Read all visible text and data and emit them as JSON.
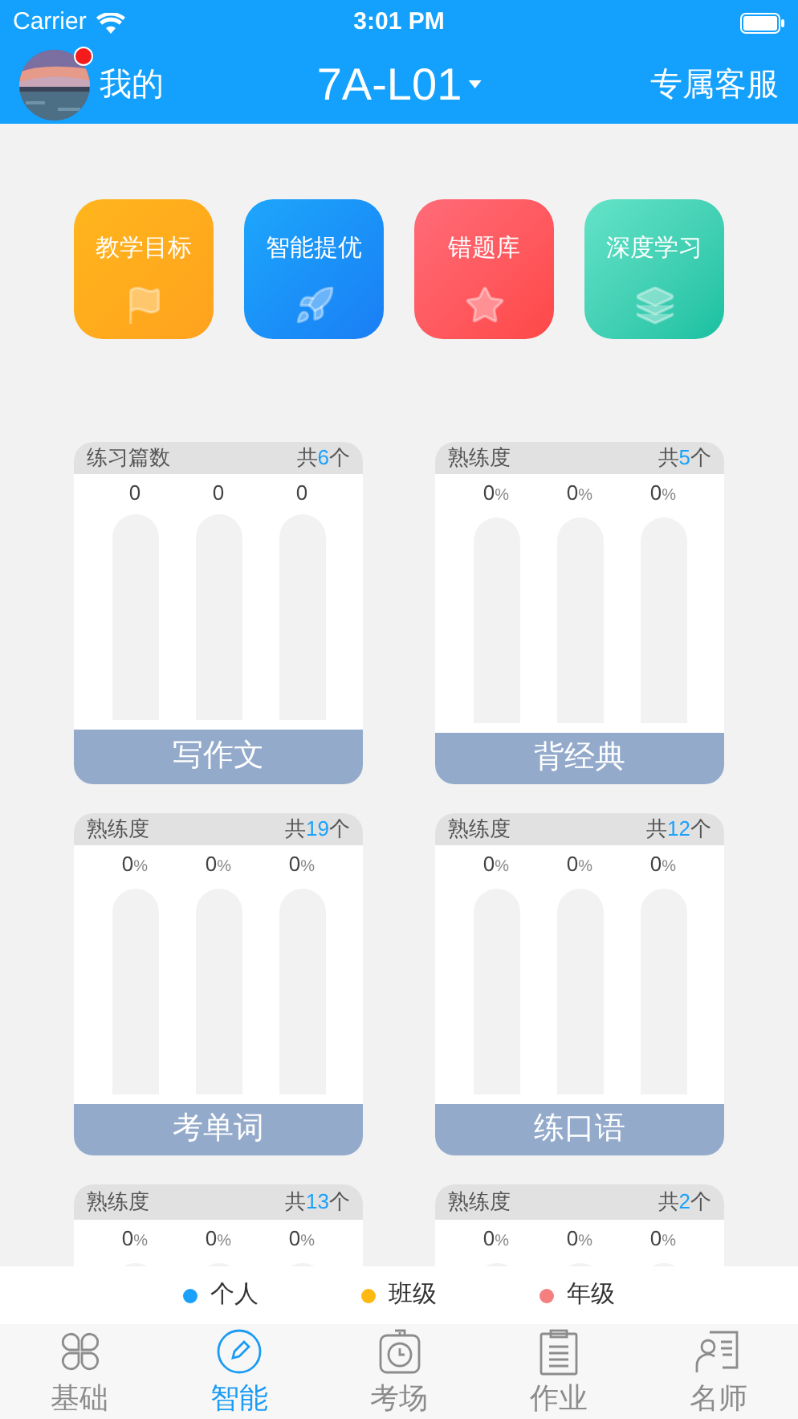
{
  "status_bar": {
    "carrier": "Carrier",
    "time": "3:01 PM"
  },
  "header": {
    "profile_label": "我的",
    "has_notification": true,
    "class_name": "7A-L01",
    "service": "专属客服"
  },
  "tiles": [
    {
      "label": "教学目标",
      "kind": "flag"
    },
    {
      "label": "智能提优",
      "kind": "rocket"
    },
    {
      "label": "错题库",
      "kind": "star"
    },
    {
      "label": "深度学习",
      "kind": "layers"
    }
  ],
  "cards": [
    {
      "title": "练习篇数",
      "total_prefix": "共",
      "total": "6",
      "total_suffix": "个",
      "bars": [
        {
          "value": "0"
        },
        {
          "value": "0"
        },
        {
          "value": "0"
        }
      ],
      "action": "写作文"
    },
    {
      "title": "熟练度",
      "total_prefix": "共",
      "total": "5",
      "total_suffix": "个",
      "bars": [
        {
          "value": "0",
          "unit": "%"
        },
        {
          "value": "0",
          "unit": "%"
        },
        {
          "value": "0",
          "unit": "%"
        }
      ],
      "action": "背经典"
    },
    {
      "title": "熟练度",
      "total_prefix": "共",
      "total": "19",
      "total_suffix": "个",
      "bars": [
        {
          "value": "0",
          "unit": "%"
        },
        {
          "value": "0",
          "unit": "%"
        },
        {
          "value": "0",
          "unit": "%"
        }
      ],
      "action": "考单词"
    },
    {
      "title": "熟练度",
      "total_prefix": "共",
      "total": "12",
      "total_suffix": "个",
      "bars": [
        {
          "value": "0",
          "unit": "%"
        },
        {
          "value": "0",
          "unit": "%"
        },
        {
          "value": "0",
          "unit": "%"
        }
      ],
      "action": "练口语"
    },
    {
      "title": "熟练度",
      "total_prefix": "共",
      "total": "13",
      "total_suffix": "个",
      "bars": [
        {
          "value": "0",
          "unit": "%"
        },
        {
          "value": "0",
          "unit": "%"
        },
        {
          "value": "0",
          "unit": "%"
        }
      ]
    },
    {
      "title": "熟练度",
      "total_prefix": "共",
      "total": "2",
      "total_suffix": "个",
      "bars": [
        {
          "value": "0",
          "unit": "%"
        },
        {
          "value": "0",
          "unit": "%"
        },
        {
          "value": "0",
          "unit": "%"
        }
      ]
    }
  ],
  "legend": [
    {
      "label": "个人",
      "color": "#1aa1fb"
    },
    {
      "label": "班级",
      "color": "#fdb813"
    },
    {
      "label": "年级",
      "color": "#f57f7f"
    }
  ],
  "tab_bar": [
    {
      "label": "基础",
      "kind": "clover",
      "selected": false
    },
    {
      "label": "智能",
      "kind": "pencil",
      "selected": true
    },
    {
      "label": "考场",
      "kind": "timer",
      "selected": false
    },
    {
      "label": "作业",
      "kind": "clipboard",
      "selected": false
    },
    {
      "label": "名师",
      "kind": "teacher",
      "selected": false
    }
  ]
}
